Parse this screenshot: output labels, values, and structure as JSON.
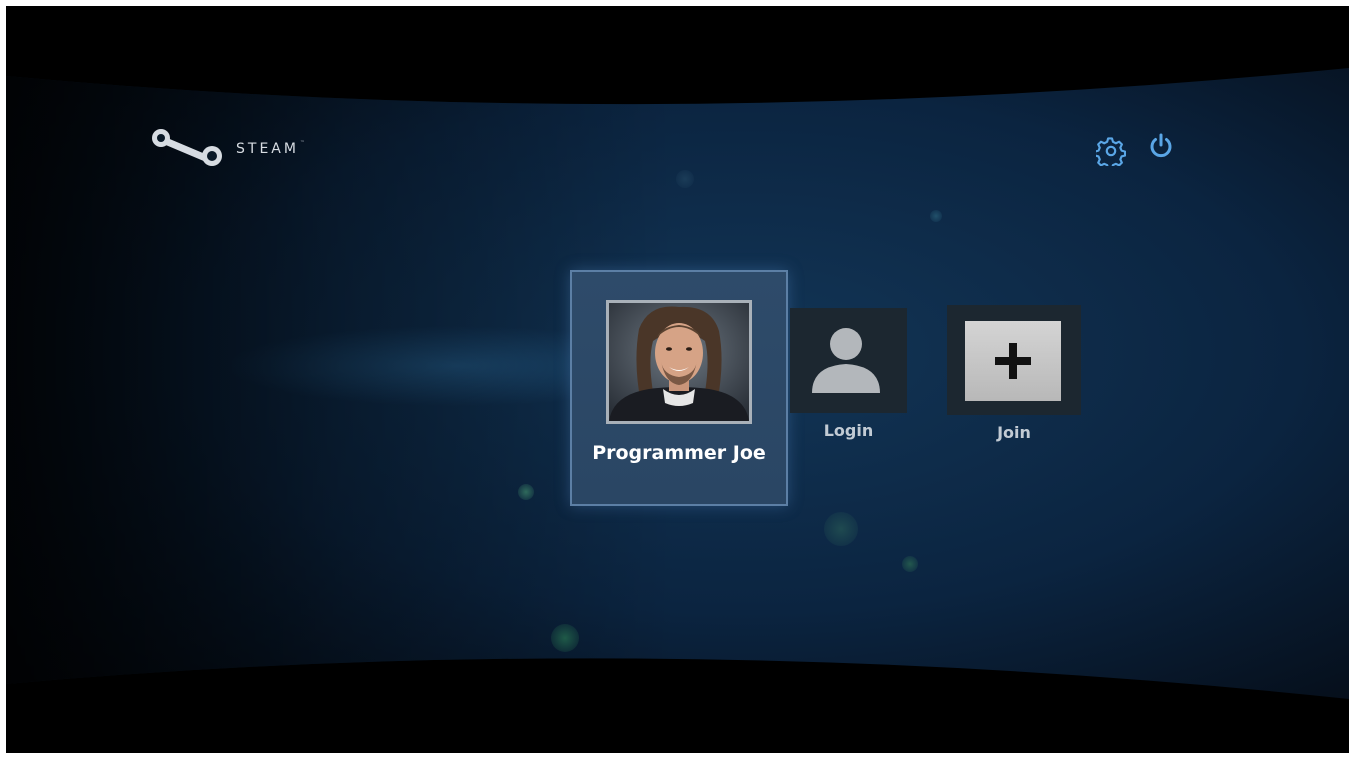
{
  "brand": {
    "name": "STEAM",
    "trademark": "™",
    "logo_icon": "steam-logo-icon"
  },
  "top_controls": {
    "settings_icon": "gear-icon",
    "power_icon": "power-icon"
  },
  "accounts": [
    {
      "name": "Programmer Joe",
      "avatar_icon": "user-photo",
      "selected": true
    }
  ],
  "actions": {
    "login": {
      "label": "Login",
      "icon": "user-silhouette-icon"
    },
    "join": {
      "label": "Join",
      "icon": "plus-icon"
    }
  },
  "colors": {
    "background": "#0b2136",
    "selected_card": "#2e4b6a",
    "selected_border": "#5c7fa5",
    "tile": "#1c2730",
    "label": "#c2cbd4"
  }
}
